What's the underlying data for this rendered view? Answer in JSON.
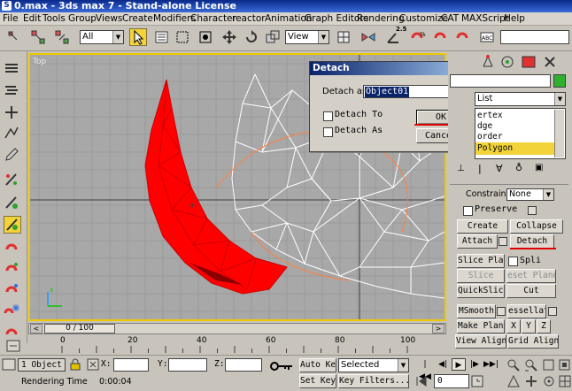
{
  "window": {
    "title": "0.max - 3ds max 7 - Stand-alone License"
  },
  "menu": [
    "File",
    "Edit",
    "Tools",
    "Group",
    "Views",
    "Create",
    "Modifiers",
    "Character",
    "reactor",
    "Animation",
    "Graph Editors",
    "Rendering",
    "Customize",
    "CAT",
    "MAXScript",
    "Help"
  ],
  "toolbar": {
    "selection_filter": "All",
    "ref_coord": "View",
    "angle_snap_value": "2.5"
  },
  "viewport": {
    "label": "Top"
  },
  "detach_dialog": {
    "title": "Detach",
    "close_glyph": "×",
    "detach_as_label": "Detach as:",
    "detach_as_value": "Object01",
    "detach_to_label": "Detach To",
    "detach_as_clone_label": "Detach As",
    "ok_label": "OK",
    "cancel_label": "Cancel"
  },
  "command_panel": {
    "modifier_list": "List",
    "stack_items": [
      "ertex",
      "dge",
      "order",
      "Polygon"
    ],
    "constraints_label": "Constraints:",
    "constraints_value": "None",
    "preserve_label": "Preserve",
    "create_label": "Create",
    "collapse_label": "Collapse",
    "attach_label": "Attach",
    "detach_label": "Detach",
    "slice_plane_label": "Slice Plane",
    "split_label": "Spli",
    "slice_label": "Slice",
    "reset_plane_label": "eset Plane",
    "quickslice_label": "QuickSlice",
    "cut_label": "Cut",
    "msmooth_label": "MSmooth",
    "tessellate_label": "essellat",
    "make_planar_label": "Make Planar",
    "x_label": "X",
    "y_label": "Y",
    "z_label": "Z",
    "view_align_label": "View Align",
    "grid_align_label": "Grid Align"
  },
  "timeline": {
    "frame_label": "0 / 100"
  },
  "ruler": {
    "ticks": [
      "0",
      "20",
      "40",
      "60",
      "80",
      "100"
    ]
  },
  "status": {
    "selection_count": "1 Object",
    "x_label": "X:",
    "y_label": "Y:",
    "z_label": "Z:",
    "rendering_time_label": "Rendering Time",
    "rendering_time_value": "0:00:04",
    "auto_key_label": "Auto Key",
    "set_key_label": "Set Key",
    "key_mode_value": "Selected",
    "key_filters_label": "Key Filters...",
    "frame_value": "0"
  },
  "colors": {
    "polygon_red": "#ff0000",
    "highlight_yellow": "#f2d43a",
    "annotation_red": "#e00000"
  }
}
